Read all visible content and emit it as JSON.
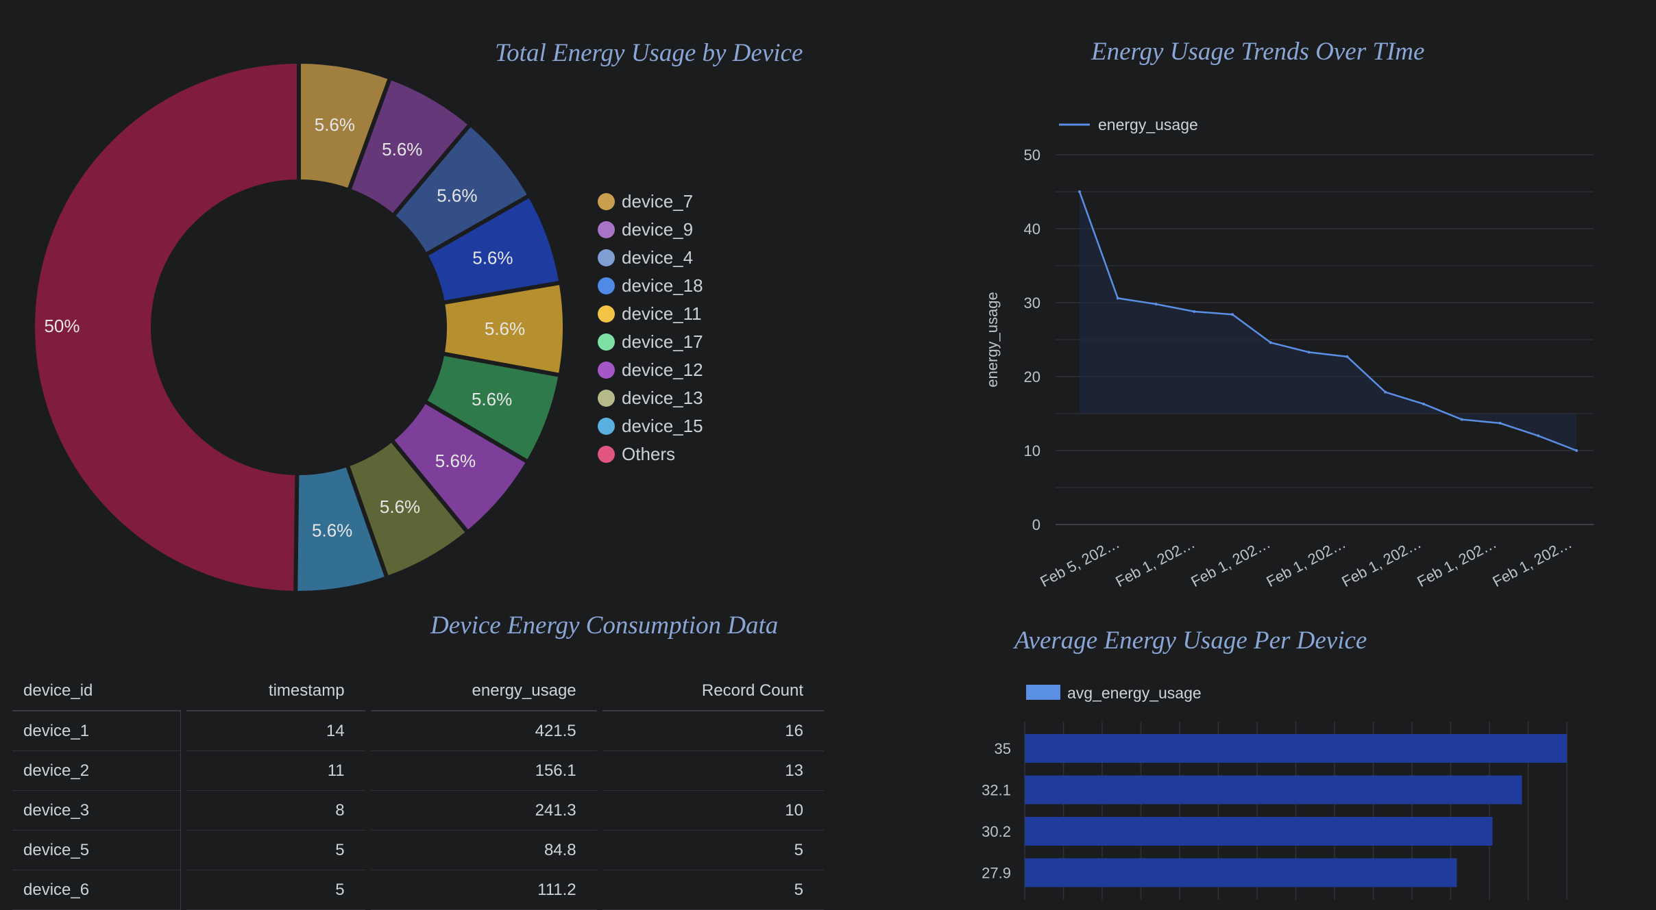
{
  "chart_data": [
    {
      "type": "pie",
      "title": "Total Energy Usage by Device",
      "labels": [
        "device_7",
        "device_9",
        "device_4",
        "device_18",
        "device_11",
        "device_17",
        "device_12",
        "device_13",
        "device_15",
        "Others"
      ],
      "values": [
        5.6,
        5.6,
        5.6,
        5.6,
        5.6,
        5.6,
        5.6,
        5.6,
        5.6,
        50
      ],
      "slice_labels": [
        "5.6%",
        "5.6%",
        "5.6%",
        "5.6%",
        "5.6%",
        "5.6%",
        "5.6%",
        "5.6%",
        "5.6%",
        "50%"
      ],
      "colors": [
        "#a17f3f",
        "#65387a",
        "#344f86",
        "#1e3c9f",
        "#b6902f",
        "#2f7a4b",
        "#7e3f9a",
        "#5e6537",
        "#336e93",
        "#801c3c"
      ],
      "legend_colors": [
        "#c89f4f",
        "#a874c8",
        "#7f9fd2",
        "#4e8ae6",
        "#f2c344",
        "#7fe0a5",
        "#a557c7",
        "#b6ba88",
        "#5ab0e0",
        "#e05680"
      ],
      "legend_position": "right",
      "donut": true
    },
    {
      "type": "area",
      "title": "Energy Usage Trends Over TIme",
      "ylabel": "energy_usage",
      "series": [
        {
          "name": "energy_usage",
          "values": [
            45,
            30.6,
            29.8,
            28.8,
            28.4,
            24.6,
            23.3,
            22.7,
            17.9,
            16.3,
            14.2,
            13.7,
            12,
            10
          ]
        }
      ],
      "x_tick_labels": [
        "Feb 5, 202…",
        "Feb 1, 202…",
        "Feb 1, 202…",
        "Feb 1, 202…",
        "Feb 1, 202…",
        "Feb 1, 202…",
        "Feb 1, 202…"
      ],
      "ylim": [
        0,
        50
      ],
      "y_ticks": [
        0,
        10,
        20,
        30,
        40,
        50
      ],
      "grid": true,
      "legend_position": "top-left",
      "color": "#5b8fe6"
    },
    {
      "type": "bar",
      "orientation": "horizontal",
      "title": "Average Energy Usage Per Device",
      "categories": [
        "35",
        "32.1",
        "30.2",
        "27.9"
      ],
      "series": [
        {
          "name": "avg_energy_usage",
          "values": [
            35,
            32.1,
            30.2,
            27.9
          ]
        }
      ],
      "xlim": [
        0,
        35
      ],
      "legend_position": "top-left",
      "color": "#1f3b9c",
      "legend_color": "#5b8fe6"
    },
    {
      "type": "table",
      "title": "Device Energy Consumption Data",
      "columns": [
        "device_id",
        "timestamp",
        "energy_usage",
        "Record Count"
      ],
      "rows": [
        [
          "device_1",
          "14",
          "421.5",
          "16"
        ],
        [
          "device_2",
          "11",
          "156.1",
          "13"
        ],
        [
          "device_3",
          "8",
          "241.3",
          "10"
        ],
        [
          "device_5",
          "5",
          "84.8",
          "5"
        ],
        [
          "device_6",
          "5",
          "111.2",
          "5"
        ]
      ]
    }
  ]
}
